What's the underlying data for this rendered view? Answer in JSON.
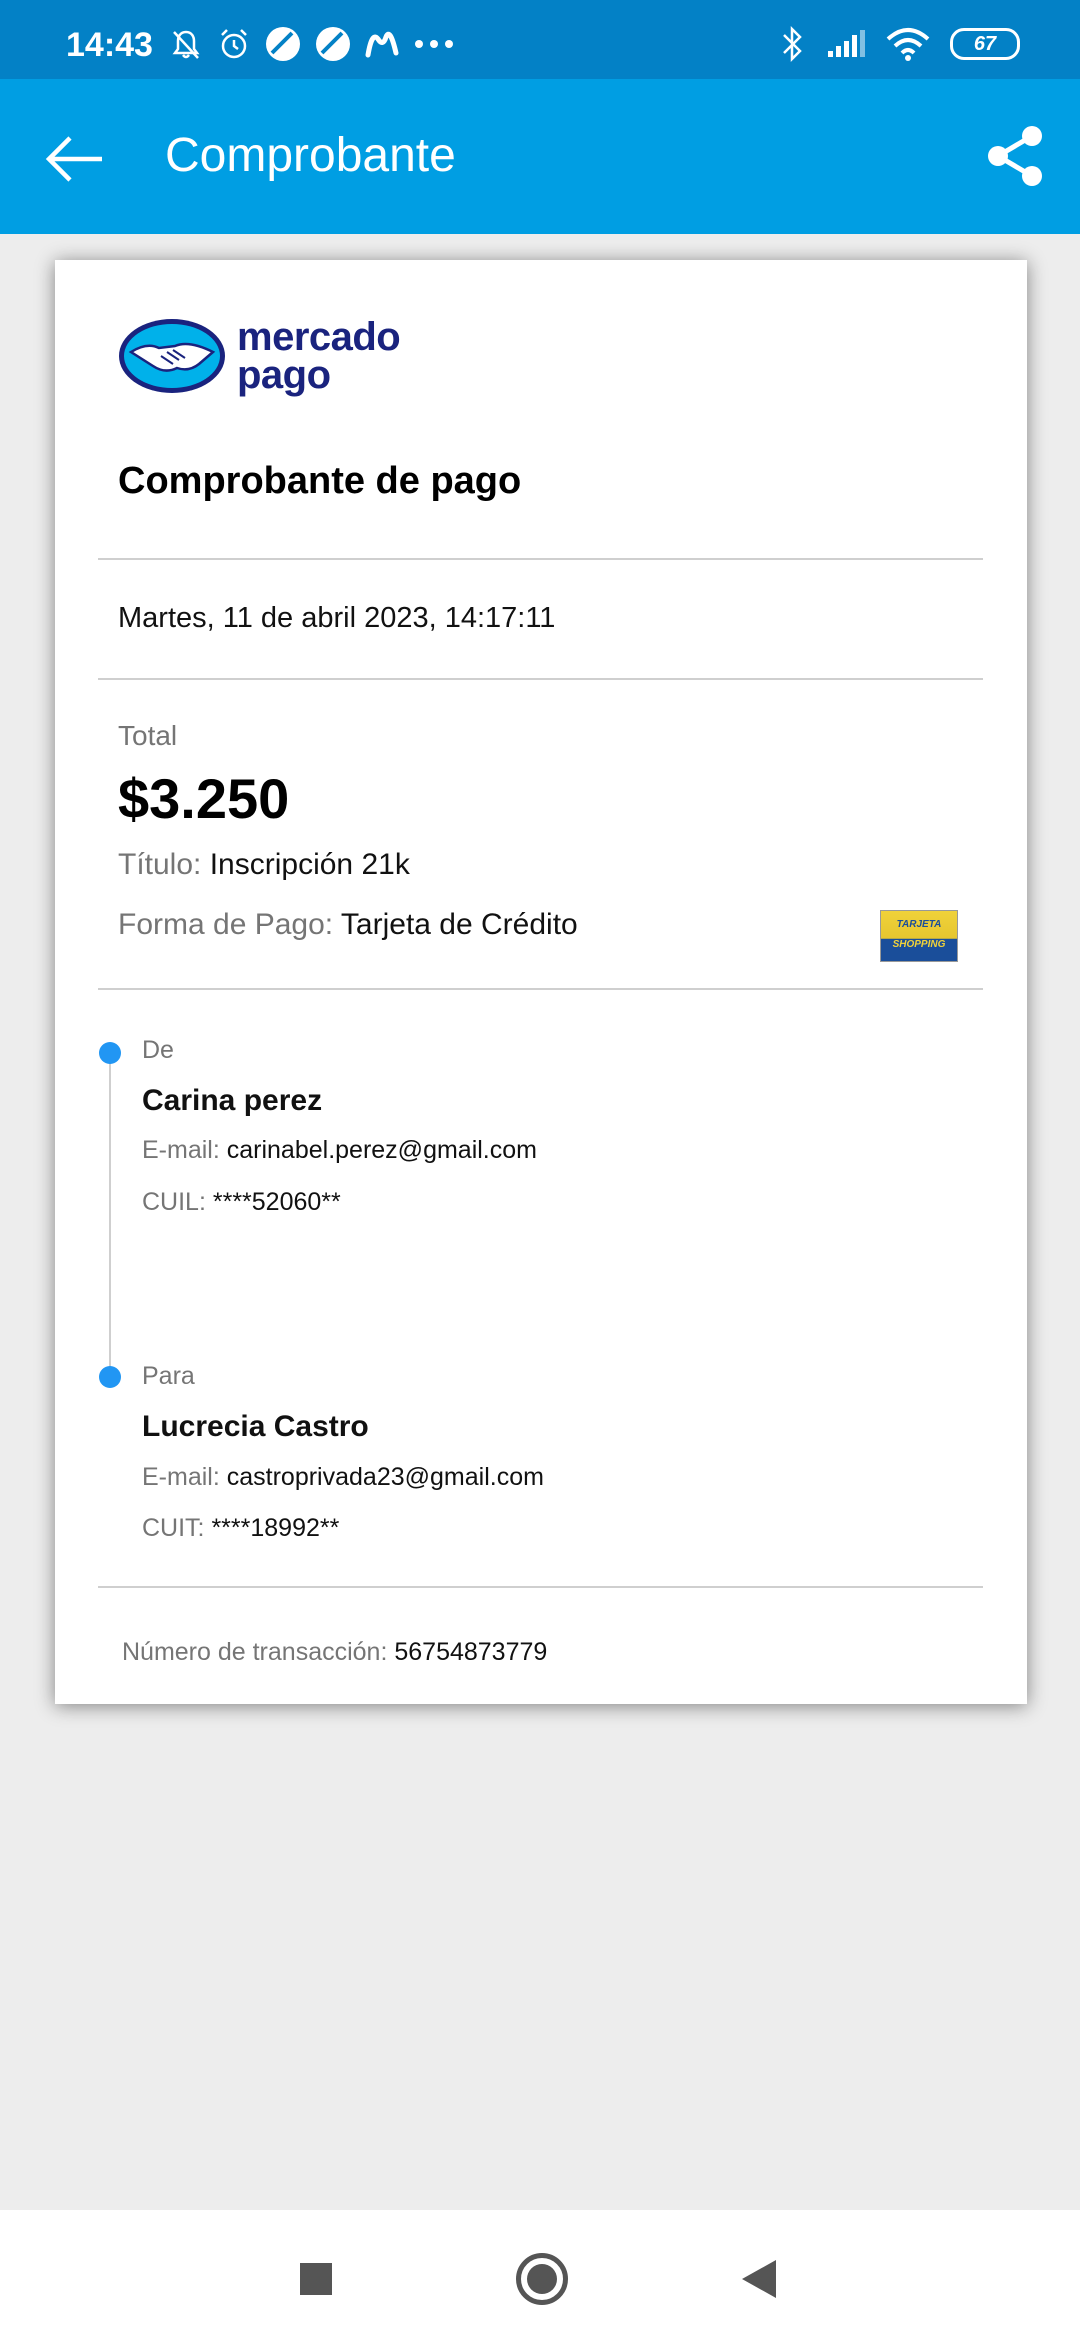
{
  "status_bar": {
    "time": "14:43",
    "battery": "67"
  },
  "app_bar": {
    "title": "Comprobante"
  },
  "receipt": {
    "logo_line1": "mercado",
    "logo_line2": "pago",
    "title": "Comprobante de pago",
    "date": "Martes, 11 de abril 2023, 14:17:11",
    "total_label": "Total",
    "total_value": "$3.250",
    "titulo_label": "Título:",
    "titulo_value": "Inscripción 21k",
    "forma_label": "Forma de Pago:",
    "forma_value": "Tarjeta de Crédito",
    "card_brand_top": "TARJETA",
    "card_brand_bottom": "SHOPPING",
    "from": {
      "label": "De",
      "name": "Carina perez",
      "email_label": "E-mail:",
      "email": "carinabel.perez@gmail.com",
      "id_label": "CUIL:",
      "id": "****52060**"
    },
    "to": {
      "label": "Para",
      "name": "Lucrecia Castro",
      "email_label": "E-mail:",
      "email": "castroprivada23@gmail.com",
      "id_label": "CUIT:",
      "id": "****18992**"
    },
    "txn_label": "Número de transacción:",
    "txn_value": "56754873779"
  },
  "colors": {
    "app_bar": "#009ee3",
    "status_bar": "#0381c6",
    "timeline_dot": "#2196f3",
    "logo_text": "#1a237e"
  }
}
